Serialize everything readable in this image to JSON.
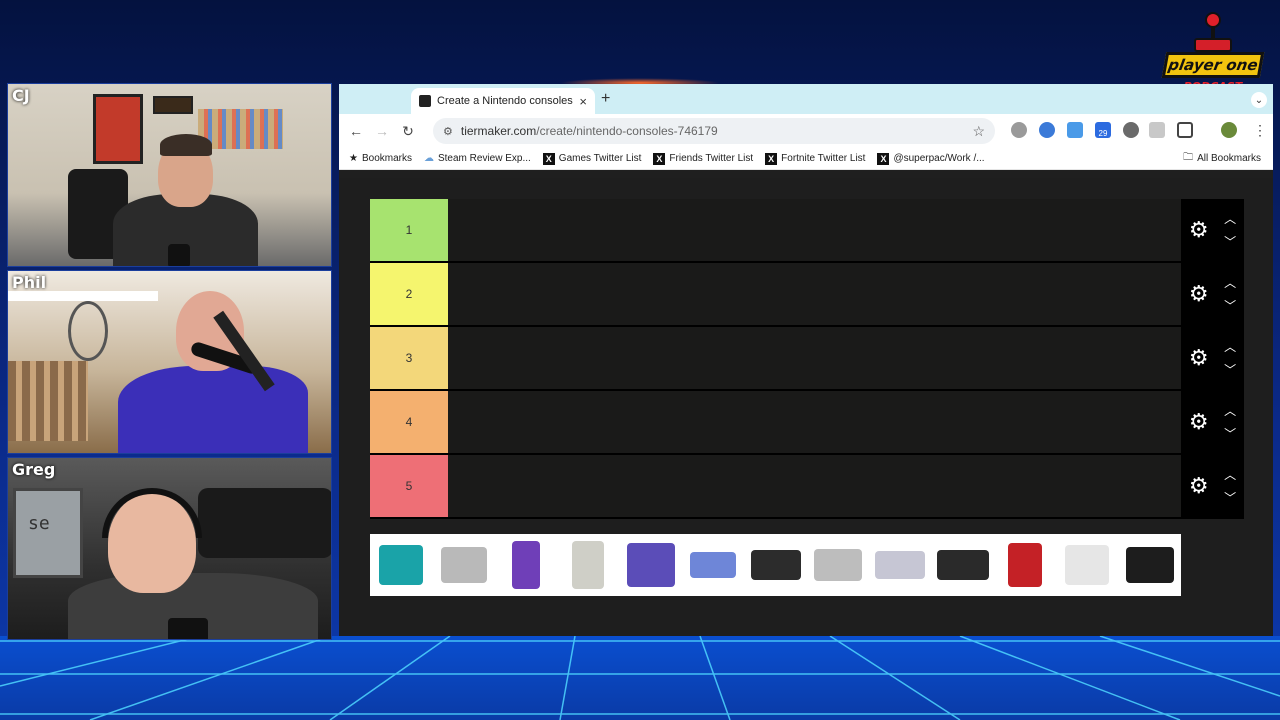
{
  "participants": [
    {
      "name": "CJ"
    },
    {
      "name": "Phil"
    },
    {
      "name": "Greg"
    }
  ],
  "logo": {
    "title": "player one",
    "subtitle": "PODCAST"
  },
  "browser": {
    "tab_title": "Create a Nintendo consoles T",
    "tab_close": "×",
    "new_tab": "+",
    "url_host": "tiermaker.com",
    "url_path": "/create/nintendo-consoles-746179",
    "extension_badge": "29",
    "bookmarks": [
      {
        "label": "Bookmarks",
        "icon": "star-icon"
      },
      {
        "label": "Steam Review Exp...",
        "icon": "steam-icon"
      },
      {
        "label": "Games Twitter List",
        "icon": "x-icon"
      },
      {
        "label": "Friends Twitter List",
        "icon": "x-icon"
      },
      {
        "label": "Fortnite Twitter List",
        "icon": "x-icon"
      },
      {
        "label": "@superpac/Work /...",
        "icon": "x-icon"
      }
    ],
    "all_bookmarks": "All Bookmarks"
  },
  "tiers": [
    {
      "label": "1",
      "color": "#a7e36f"
    },
    {
      "label": "2",
      "color": "#f5f56e"
    },
    {
      "label": "3",
      "color": "#f3d77a"
    },
    {
      "label": "4",
      "color": "#f4b06f"
    },
    {
      "label": "5",
      "color": "#ee6f76"
    }
  ],
  "tray_items": [
    {
      "name": "nintendo-3ds",
      "color": "#1aa3a8"
    },
    {
      "name": "nintendo-ds-lite",
      "color": "#b9b9b9"
    },
    {
      "name": "game-boy-color",
      "color": "#6f3fb8"
    },
    {
      "name": "game-boy",
      "color": "#cfcfc7"
    },
    {
      "name": "gamecube",
      "color": "#5b4db8"
    },
    {
      "name": "game-boy-advance",
      "color": "#6e86d8"
    },
    {
      "name": "nintendo-64",
      "color": "#2c2c2c"
    },
    {
      "name": "nes",
      "color": "#bdbdbd"
    },
    {
      "name": "snes",
      "color": "#c6c6d4"
    },
    {
      "name": "nintendo-switch",
      "color": "#2a2a2a"
    },
    {
      "name": "virtual-boy",
      "color": "#c42126"
    },
    {
      "name": "wii",
      "color": "#e6e6e6"
    },
    {
      "name": "wii-u",
      "color": "#1d1d1d"
    }
  ]
}
